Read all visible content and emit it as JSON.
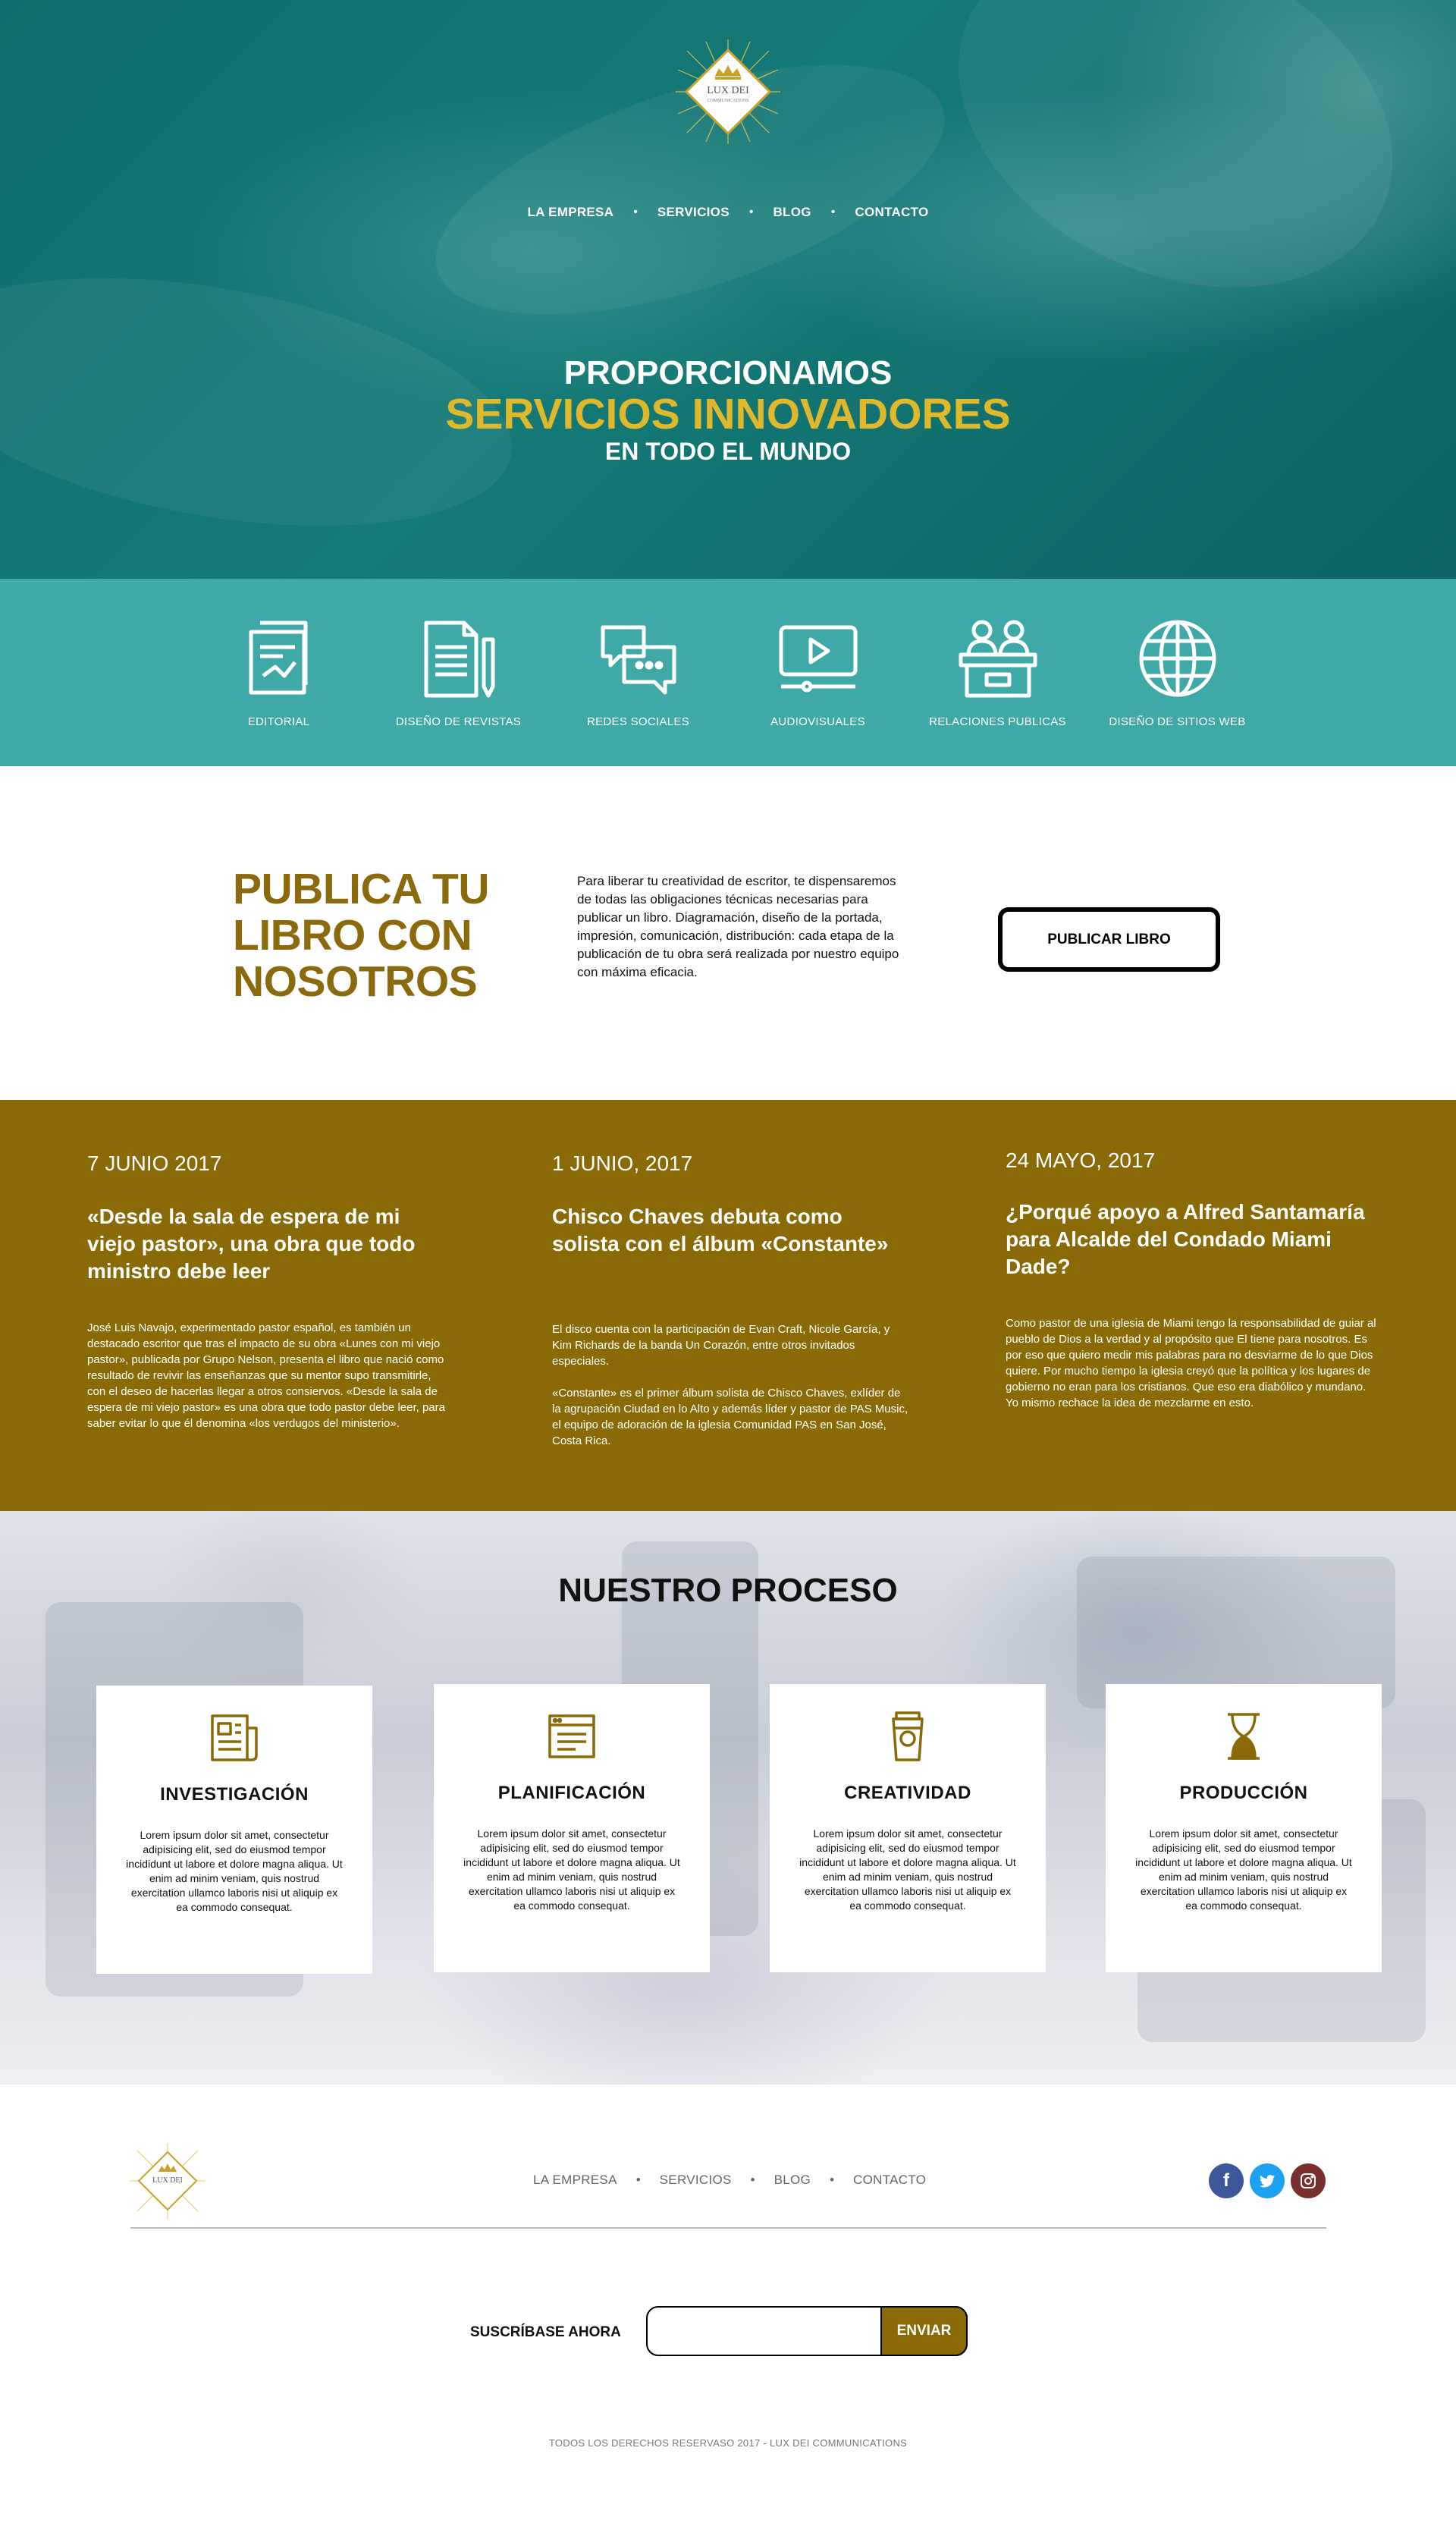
{
  "brand": {
    "name": "LUX DEI",
    "sub": "COMMUNICATIONS"
  },
  "nav": {
    "items": [
      "LA EMPRESA",
      "SERVICIOS",
      "BLOG",
      "CONTACTO"
    ]
  },
  "hero": {
    "line1": "PROPORCIONAMOS",
    "line2": "SERVICIOS INNOVADORES",
    "line3": "EN TODO EL MUNDO"
  },
  "services": [
    {
      "label": "EDITORIAL",
      "icon": "editorial-icon"
    },
    {
      "label": "DISEÑO DE REVISTAS",
      "icon": "magazine-design-icon"
    },
    {
      "label": "REDES SOCIALES",
      "icon": "chat-bubbles-icon"
    },
    {
      "label": "AUDIOVISUALES",
      "icon": "video-player-icon"
    },
    {
      "label": "RELACIONES PUBLICAS",
      "icon": "people-podium-icon"
    },
    {
      "label": "DISEÑO DE SITIOS WEB",
      "icon": "globe-icon"
    }
  ],
  "publica": {
    "title_line1": "PUBLICA TU",
    "title_line2": "LIBRO CON",
    "title_line3": "NOSOTROS",
    "text": "Para liberar tu creatividad de escritor, te dispensaremos de todas las obligaciones técnicas necesarias para publicar un libro. Diagramación, diseño de la portada, impresión, comunicación, distribución: cada etapa de la publicación de tu obra será realizada por nuestro equipo con máxima eficacia.",
    "button": "PUBLICAR LIBRO"
  },
  "news": [
    {
      "date": "7 JUNIO 2017",
      "title": "«Desde la sala de espera de mi viejo pastor», una obra que todo ministro debe leer",
      "body": [
        "José Luis Navajo, experimentado pastor español, es también un destacado escritor que tras el impacto de su obra «Lunes con mi viejo pastor», publicada por Grupo Nelson, presenta el libro que nació como resultado de revivir las enseñanzas que su mentor supo transmitirle, con el deseo de hacerlas llegar a otros consiervos. «Desde la sala de espera de mi viejo pastor» es una obra que todo pastor debe leer, para saber evitar lo que él denomina «los verdugos del ministerio»."
      ]
    },
    {
      "date": "1 JUNIO, 2017",
      "title": "Chisco Chaves debuta como solista con el álbum «Constante»",
      "body": [
        "El disco cuenta con la participación de Evan Craft, Nicole García, y Kim Richards de la banda Un Corazón, entre otros invitados especiales.",
        "«Constante» es el primer álbum solista de Chisco Chaves, exlíder de la agrupación Ciudad en lo Alto y además líder y pastor de PAS Music, el equipo de adoración de la iglesia Comunidad PAS en San José, Costa Rica."
      ]
    },
    {
      "date": "24 MAYO, 2017",
      "title": "¿Porqué apoyo a Alfred Santamaría para Alcalde del Condado Miami Dade?",
      "body": [
        "Como pastor de una iglesia de Miami tengo la responsabilidad de guiar al pueblo de Dios a la verdad y al propósito que El tiene para nosotros. Es por eso que quiero medir mis palabras para no desviarme de lo que Dios quiere. Por mucho tiempo la iglesia creyó que la política y los lugares de gobierno no eran para los cristianos. Que eso era diabólico y mundano. Yo mismo rechace la idea de mezclarme en esto."
      ]
    }
  ],
  "proceso": {
    "title": "NUESTRO PROCESO",
    "cards": [
      {
        "title": "INVESTIGACIÓN",
        "icon": "newspaper-icon",
        "text": "Lorem ipsum dolor sit amet, consectetur adipisicing elit, sed do eiusmod tempor incididunt ut labore et dolore magna aliqua. Ut enim ad minim veniam, quis nostrud exercitation ullamco laboris nisi ut aliquip ex ea commodo consequat."
      },
      {
        "title": "PLANIFICACIÓN",
        "icon": "browser-window-icon",
        "text": "Lorem ipsum dolor sit amet, consectetur adipisicing elit, sed do eiusmod tempor incididunt ut labore et dolore magna aliqua. Ut enim ad minim veniam, quis nostrud exercitation ullamco laboris nisi ut aliquip ex ea commodo consequat."
      },
      {
        "title": "CREATIVIDAD",
        "icon": "coffee-cup-icon",
        "text": "Lorem ipsum dolor sit amet, consectetur adipisicing elit, sed do eiusmod tempor incididunt ut labore et dolore magna aliqua. Ut enim ad minim veniam, quis nostrud exercitation ullamco laboris nisi ut aliquip ex ea commodo consequat."
      },
      {
        "title": "PRODUCCIÓN",
        "icon": "hourglass-icon",
        "text": "Lorem ipsum dolor sit amet, consectetur adipisicing elit, sed do eiusmod tempor incididunt ut labore et dolore magna aliqua. Ut enim ad minim veniam, quis nostrud exercitation ullamco laboris nisi ut aliquip ex ea commodo consequat."
      }
    ]
  },
  "footer": {
    "nav": [
      "LA EMPRESA",
      "SERVICIOS",
      "BLOG",
      "CONTACTO"
    ],
    "social": [
      "facebook-icon",
      "twitter-icon",
      "instagram-icon"
    ],
    "subscribe_label": "SUSCRÍBASE AHORA",
    "subscribe_placeholder": "",
    "subscribe_button": "ENVIAR",
    "copyright": "TODOS LOS DERECHOS RESERVASO 2017 - LUX DEI COMMUNICATIONS"
  },
  "colors": {
    "teal_dark": "#0f6f6c",
    "teal_band": "#3fa9a8",
    "gold": "#8a6a07",
    "gold_text": "#8a6a0c",
    "hero_yellow": "#e0b82b"
  }
}
